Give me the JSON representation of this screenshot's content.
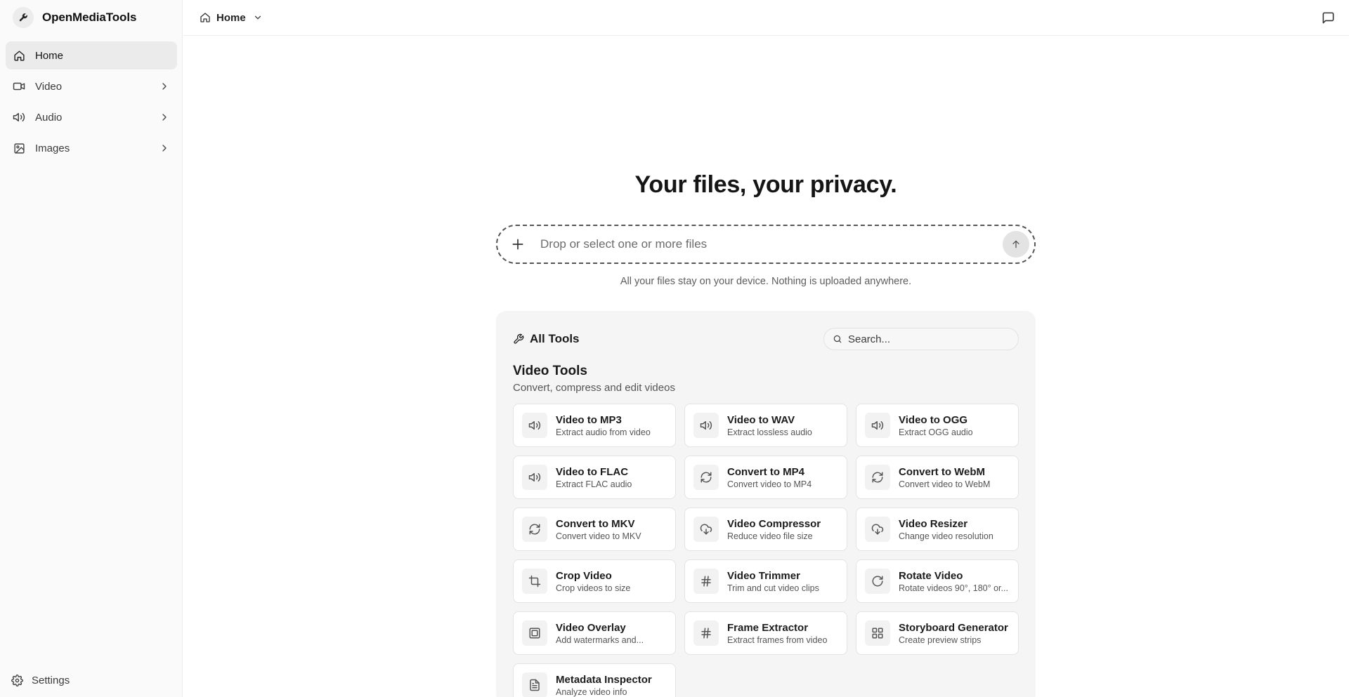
{
  "app": {
    "name": "OpenMediaTools"
  },
  "sidebar": {
    "items": [
      {
        "label": "Home",
        "icon": "home-icon",
        "active": true
      },
      {
        "label": "Video",
        "icon": "video-icon",
        "expandable": true
      },
      {
        "label": "Audio",
        "icon": "speaker-icon",
        "expandable": true
      },
      {
        "label": "Images",
        "icon": "image-icon",
        "expandable": true
      }
    ],
    "settings_label": "Settings"
  },
  "topbar": {
    "breadcrumb": "Home"
  },
  "hero": {
    "title": "Your files, your privacy.",
    "dropzone_placeholder": "Drop or select one or more files",
    "privacy_note": "All your files stay on your device. Nothing is uploaded anywhere."
  },
  "tools": {
    "heading": "All Tools",
    "search_placeholder": "Search...",
    "section": {
      "title": "Video Tools",
      "subtitle": "Convert, compress and edit videos",
      "cards": [
        {
          "title": "Video to MP3",
          "desc": "Extract audio from video",
          "icon": "speaker"
        },
        {
          "title": "Video to WAV",
          "desc": "Extract lossless audio",
          "icon": "speaker"
        },
        {
          "title": "Video to OGG",
          "desc": "Extract OGG audio",
          "icon": "speaker"
        },
        {
          "title": "Video to FLAC",
          "desc": "Extract FLAC audio",
          "icon": "speaker"
        },
        {
          "title": "Convert to MP4",
          "desc": "Convert video to MP4",
          "icon": "refresh"
        },
        {
          "title": "Convert to WebM",
          "desc": "Convert video to WebM",
          "icon": "refresh"
        },
        {
          "title": "Convert to MKV",
          "desc": "Convert video to MKV",
          "icon": "refresh"
        },
        {
          "title": "Video Compressor",
          "desc": "Reduce video file size",
          "icon": "download-cloud"
        },
        {
          "title": "Video Resizer",
          "desc": "Change video resolution",
          "icon": "download-cloud"
        },
        {
          "title": "Crop Video",
          "desc": "Crop videos to size",
          "icon": "crop"
        },
        {
          "title": "Video Trimmer",
          "desc": "Trim and cut video clips",
          "icon": "hash"
        },
        {
          "title": "Rotate Video",
          "desc": "Rotate videos 90°, 180° or...",
          "icon": "rotate"
        },
        {
          "title": "Video Overlay",
          "desc": "Add watermarks and...",
          "icon": "overlay"
        },
        {
          "title": "Frame Extractor",
          "desc": "Extract frames from video",
          "icon": "hash"
        },
        {
          "title": "Storyboard Generator",
          "desc": "Create preview strips",
          "icon": "grid"
        },
        {
          "title": "Metadata Inspector",
          "desc": "Analyze video info",
          "icon": "file"
        }
      ]
    }
  },
  "colors": {
    "sidebar_bg": "#fafafa",
    "active_item": "#ebebeb",
    "panel_bg": "#f5f5f5",
    "text": "#171717"
  }
}
